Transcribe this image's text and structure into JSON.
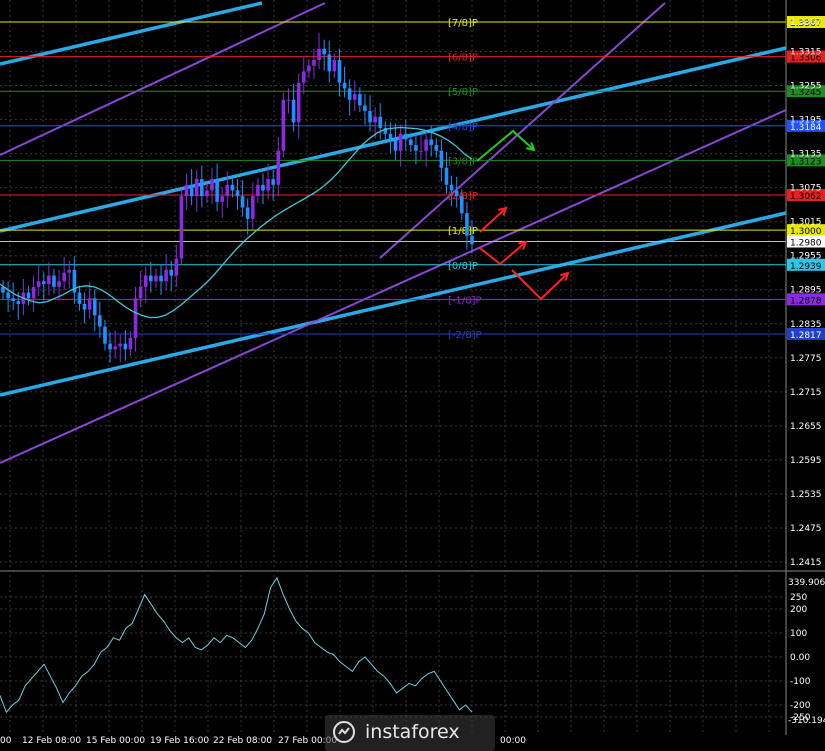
{
  "colors": {
    "background": "#000000",
    "grid": "#3a3a3a",
    "bull": "#8a2be2",
    "bear": "#1e90ff",
    "ma": "#40c8d8",
    "channel_cyan": "#29a9e6",
    "channel_purple": "#8a46d6",
    "cci": "#6fd3e0",
    "forecast_up": "#22cc22",
    "forecast_red": "#ff2020"
  },
  "chart_data": [
    {
      "type": "candlestick",
      "name": "main",
      "ylim": [
        2397,
        3390
      ],
      "yticks": [
        1.3367,
        1.3315,
        1.3255,
        1.3195,
        1.3135,
        1.3075,
        1.3015,
        1.2955,
        1.2895,
        1.2835,
        1.2775,
        1.2715,
        1.2655,
        1.2595,
        1.2535,
        1.2475,
        1.2415
      ],
      "xlabels": [
        "00",
        "12 Feb 08:00",
        "15 Feb 00:00",
        "19 Feb 16:00",
        "22 Feb 08:00",
        "27 Feb 00:00",
        "00:00"
      ],
      "murrey_levels": [
        {
          "label": "[7/8]P",
          "price": 1.3367,
          "tag": "1.3367",
          "color": "#e8e800",
          "tagbg": "#e8e800",
          "tagfg": "#000000"
        },
        {
          "label": "[6/8]P",
          "price": 1.3306,
          "tag": "1.3306",
          "color": "#e82020",
          "tagbg": "#e82020",
          "tagfg": "#000000"
        },
        {
          "label": "[5/8]P",
          "price": 1.3245,
          "tag": "1.3245",
          "color": "#1e8c1e",
          "tagbg": "#1e8c1e",
          "tagfg": "#000000"
        },
        {
          "label": "[4/8]P",
          "price": 1.3184,
          "tag": "1.3184",
          "color": "#2050ff",
          "tagbg": "#2050ff",
          "tagfg": "#ffffff"
        },
        {
          "label": "[3/8]P",
          "price": 1.3123,
          "tag": "1.3123",
          "color": "#1e8c1e",
          "tagbg": "#1e8c1e",
          "tagfg": "#000000"
        },
        {
          "label": "[2/8]P",
          "price": 1.3062,
          "tag": "1.3062",
          "color": "#e82020",
          "tagbg": "#e82020",
          "tagfg": "#000000"
        },
        {
          "label": "[1/8]P",
          "price": 1.3,
          "tag": "1.3000",
          "color": "#e8e800",
          "tagbg": "#e8e800",
          "tagfg": "#000000"
        },
        {
          "label": "[0/8]P",
          "price": 1.2939,
          "tag": "1.2939",
          "color": "#29c8e6",
          "tagbg": "#29c8e6",
          "tagfg": "#000000"
        },
        {
          "label": "[-1/8]P",
          "price": 1.2878,
          "tag": "1.2878",
          "color": "#8a2be2",
          "tagbg": "#8a2be2",
          "tagfg": "#000000"
        },
        {
          "label": "[-2/8]P",
          "price": 1.2817,
          "tag": "1.2817",
          "color": "#2040c8",
          "tagbg": "#2040c8",
          "tagfg": "#ffffff"
        }
      ],
      "current_price": {
        "value": 1.298,
        "tag": "1.2980"
      },
      "candles_close": [
        1.289,
        1.288,
        1.2875,
        1.287,
        1.289,
        1.288,
        1.29,
        1.291,
        1.2905,
        1.292,
        1.29,
        1.291,
        1.2925,
        1.293,
        1.289,
        1.287,
        1.286,
        1.288,
        1.285,
        1.283,
        1.28,
        1.279,
        1.2795,
        1.28,
        1.279,
        1.281,
        1.288,
        1.29,
        1.292,
        1.291,
        1.292,
        1.291,
        1.293,
        1.292,
        1.295,
        1.306,
        1.308,
        1.306,
        1.309,
        1.306,
        1.307,
        1.309,
        1.305,
        1.306,
        1.308,
        1.307,
        1.306,
        1.304,
        1.302,
        1.306,
        1.308,
        1.307,
        1.309,
        1.308,
        1.314,
        1.323,
        1.323,
        1.319,
        1.326,
        1.328,
        1.329,
        1.33,
        1.332,
        1.331,
        1.328,
        1.33,
        1.326,
        1.325,
        1.323,
        1.324,
        1.322,
        1.321,
        1.319,
        1.32,
        1.318,
        1.317,
        1.316,
        1.314,
        1.317,
        1.316,
        1.315,
        1.314,
        1.314,
        1.316,
        1.315,
        1.314,
        1.311,
        1.308,
        1.307,
        1.306,
        1.303,
        1.299,
        1.2975
      ],
      "ma": [
        1.2905,
        1.2895,
        1.2886,
        1.288,
        1.2875,
        1.2872,
        1.2874,
        1.288,
        1.2886,
        1.2894,
        1.29,
        1.2902,
        1.29,
        1.2894,
        1.2885,
        1.2874,
        1.2864,
        1.2856,
        1.285,
        1.2846,
        1.2846,
        1.285,
        1.2858,
        1.2868,
        1.288,
        1.2892,
        1.2904,
        1.2918,
        1.2934,
        1.295,
        1.2966,
        1.298,
        1.2992,
        1.3004,
        1.3015,
        1.3025,
        1.3034,
        1.3042,
        1.305,
        1.3058,
        1.3066,
        1.3076,
        1.3088,
        1.3102,
        1.3118,
        1.3134,
        1.315,
        1.3162,
        1.3172,
        1.3178,
        1.318,
        1.3181,
        1.318,
        1.3179,
        1.3176,
        1.3172,
        1.3166,
        1.3158,
        1.3148,
        1.3135,
        1.3125
      ],
      "ma_x_start": 0,
      "ma_x_end": 472
    },
    {
      "type": "line",
      "name": "CCI",
      "yticks": [
        250,
        200,
        100,
        0.0,
        -100,
        -200,
        -250
      ],
      "ytick_labels": [
        "250",
        "200",
        "100",
        "0.00",
        "-100",
        "-200",
        "-250"
      ],
      "top_label": "339.9066",
      "bottom_label": "-310.194",
      "values": [
        -160,
        -230,
        -200,
        -180,
        -120,
        -90,
        -60,
        -30,
        -80,
        -130,
        -190,
        -150,
        -120,
        -80,
        -60,
        -30,
        20,
        40,
        80,
        70,
        120,
        140,
        200,
        260,
        220,
        180,
        150,
        110,
        80,
        60,
        80,
        40,
        30,
        50,
        80,
        60,
        90,
        80,
        60,
        40,
        70,
        120,
        180,
        290,
        330,
        260,
        200,
        150,
        120,
        100,
        60,
        40,
        20,
        10,
        -20,
        -40,
        -60,
        -20,
        0,
        -30,
        -60,
        -80,
        -110,
        -150,
        -130,
        -110,
        -120,
        -90,
        -70,
        -60,
        -100,
        -140,
        -180,
        -220,
        -200,
        -230
      ]
    }
  ],
  "watermark": {
    "text": "instaforex"
  }
}
